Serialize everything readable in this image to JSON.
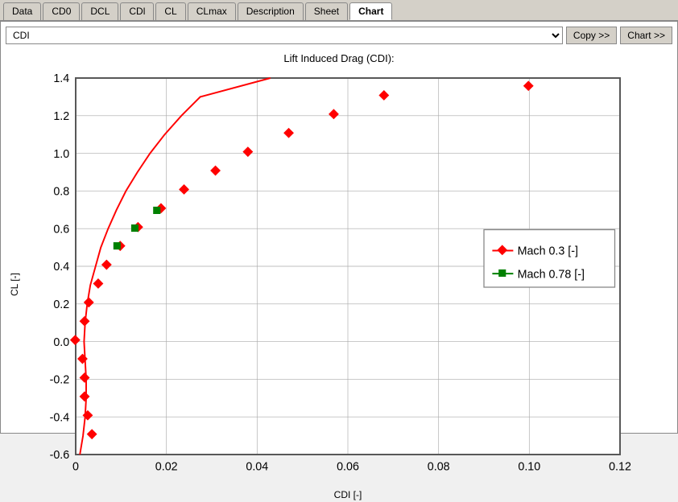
{
  "tabs": [
    {
      "label": "Data",
      "active": false
    },
    {
      "label": "CD0",
      "active": false
    },
    {
      "label": "DCL",
      "active": false
    },
    {
      "label": "CDl",
      "active": false
    },
    {
      "label": "CL",
      "active": false
    },
    {
      "label": "CLmax",
      "active": false
    },
    {
      "label": "Description",
      "active": false
    },
    {
      "label": "Sheet",
      "active": false
    },
    {
      "label": "Chart",
      "active": true
    }
  ],
  "toolbar": {
    "dropdown_value": "CDI",
    "copy_label": "Copy >>",
    "chart_label": "Chart >>"
  },
  "chart": {
    "title": "Lift Induced Drag (CDI):",
    "x_label": "CDI [-]",
    "y_label": "CL [-]",
    "x_ticks": [
      "0",
      "0.02",
      "0.04",
      "0.06",
      "0.08",
      "0.10",
      "0.12"
    ],
    "y_ticks": [
      "-0.6",
      "-0.4",
      "-0.2",
      "0.0",
      "0.2",
      "0.4",
      "0.6",
      "0.8",
      "1.0",
      "1.2",
      "1.4"
    ],
    "legend": [
      {
        "label": "Mach 0.3 [-]",
        "color": "red",
        "type": "diamond"
      },
      {
        "label": "Mach 0.78 [-]",
        "color": "green",
        "type": "square"
      }
    ]
  }
}
